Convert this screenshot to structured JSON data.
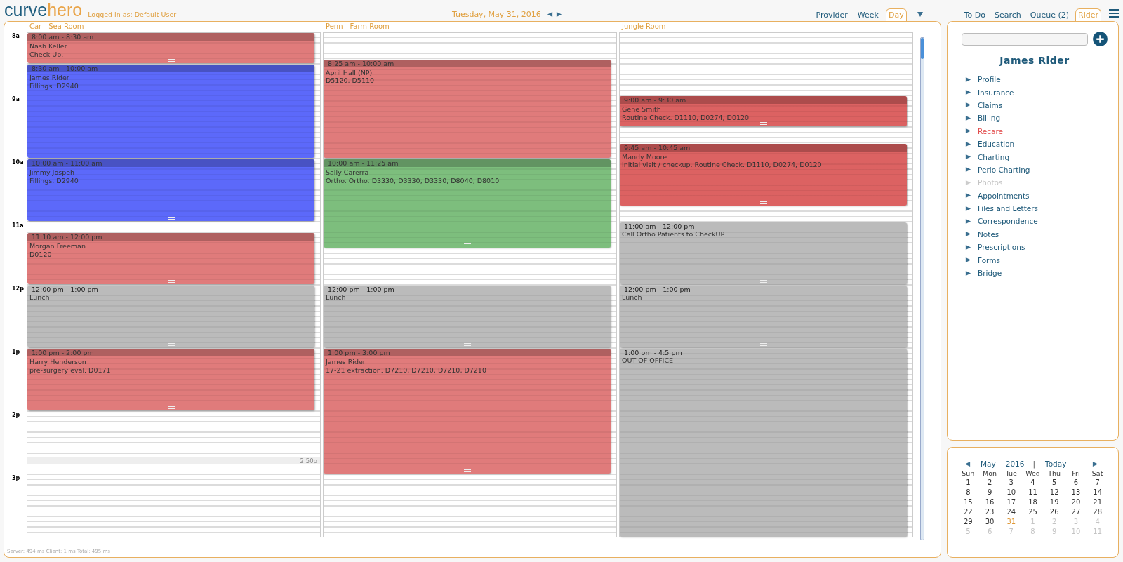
{
  "header": {
    "logo": [
      "curve",
      "hero"
    ],
    "logged_in": "Logged in as: Default User",
    "date": "Tuesday, May 31, 2016",
    "view_tabs": [
      {
        "label": "Provider",
        "selected": false
      },
      {
        "label": "Week",
        "selected": false
      },
      {
        "label": "Day",
        "selected": true
      }
    ],
    "side_tabs": [
      {
        "label": "To Do",
        "selected": false
      },
      {
        "label": "Search",
        "selected": false
      },
      {
        "label": "Queue (2)",
        "selected": false
      },
      {
        "label": "Rider",
        "selected": true
      }
    ]
  },
  "schedule": {
    "hours": [
      "8a",
      "9a",
      "10a",
      "11a",
      "12p",
      "1p",
      "2p",
      "3p"
    ],
    "columns": [
      {
        "room": "Car - Sea Room",
        "marker": "2:50p",
        "appointments": [
          {
            "kind": "appointment",
            "color": "#e07b7b",
            "time": "8:00 am - 8:30 am",
            "lines": [
              "Nash Keller",
              "Check Up."
            ]
          },
          {
            "kind": "appointment",
            "color": "#5c69fa",
            "time": "8:30 am - 10:00 am",
            "lines": [
              "James Rider",
              "Fillings. D2940"
            ]
          },
          {
            "kind": "appointment",
            "color": "#5c69fa",
            "time": "10:00 am - 11:00 am",
            "lines": [
              "Jimmy Jospeh",
              "Fillings. D2940"
            ]
          },
          {
            "kind": "appointment",
            "color": "#e07b7b",
            "time": "11:10 am - 12:00 pm",
            "lines": [
              "Morgan Freeman",
              "D0120"
            ]
          },
          {
            "kind": "block",
            "color": "#bbbbbb",
            "time": "12:00 pm - 1:00 pm",
            "lines": [
              "Lunch"
            ]
          },
          {
            "kind": "appointment",
            "color": "#e07b7b",
            "time": "1:00 pm - 2:00 pm",
            "lines": [
              "Harry Henderson",
              "pre-surgery eval. D0171"
            ]
          }
        ]
      },
      {
        "room": "Penn - Farm Room",
        "appointments": [
          {
            "kind": "appointment",
            "color": "#e07b7b",
            "time": "8:25 am - 10:00 am",
            "lines": [
              "April Hall (NP)",
              "D5120, D5110"
            ]
          },
          {
            "kind": "appointment",
            "color": "#7dbe7d",
            "time": "10:00 am - 11:25 am",
            "lines": [
              "Sally Carerra",
              "Ortho. Ortho. D3330, D3330, D3330, D8040, D8010"
            ]
          },
          {
            "kind": "block",
            "color": "#bbbbbb",
            "time": "12:00 pm - 1:00 pm",
            "lines": [
              "Lunch"
            ]
          },
          {
            "kind": "appointment",
            "color": "#e07b7b",
            "time": "1:00 pm - 3:00 pm",
            "lines": [
              "James Rider",
              "17-21 extraction. D7210, D7210, D7210, D7210"
            ]
          }
        ]
      },
      {
        "room": "Jungle Room",
        "appointments": [
          {
            "kind": "appointment",
            "color": "#dc6262",
            "time": "9:00 am - 9:30 am",
            "lines": [
              "Gene Smith",
              "Routine Check. D1110, D0274, D0120"
            ]
          },
          {
            "kind": "appointment",
            "color": "#dc6262",
            "time": "9:45 am - 10:45 am",
            "lines": [
              "Mandy Moore",
              "initial visit / checkup. Routine Check. D1110, D0274, D0120"
            ]
          },
          {
            "kind": "block",
            "color": "#bbbbbb",
            "time": "11:00 am - 12:00 pm",
            "lines": [
              "Call Ortho Patients to CheckUP"
            ]
          },
          {
            "kind": "block",
            "color": "#bbbbbb",
            "time": "12:00 pm - 1:00 pm",
            "lines": [
              "Lunch"
            ]
          },
          {
            "kind": "block",
            "color": "#bbbbbb",
            "time": "1:00 pm - 4:5 pm",
            "lines": [
              "OUT OF OFFICE"
            ]
          }
        ]
      }
    ],
    "footer": "Server: 494 ms Client: 1 ms Total: 495 ms"
  },
  "patient": {
    "name": "James Rider",
    "menu": [
      {
        "label": "Profile",
        "selected": false,
        "disabled": false
      },
      {
        "label": "Insurance",
        "selected": false,
        "disabled": false
      },
      {
        "label": "Claims",
        "selected": false,
        "disabled": false
      },
      {
        "label": "Billing",
        "selected": false,
        "disabled": false
      },
      {
        "label": "Recare",
        "selected": true,
        "disabled": false
      },
      {
        "label": "Education",
        "selected": false,
        "disabled": false
      },
      {
        "label": "Charting",
        "selected": false,
        "disabled": false
      },
      {
        "label": "Perio Charting",
        "selected": false,
        "disabled": false
      },
      {
        "label": "Photos",
        "selected": false,
        "disabled": true
      },
      {
        "label": "Appointments",
        "selected": false,
        "disabled": false
      },
      {
        "label": "Files and Letters",
        "selected": false,
        "disabled": false
      },
      {
        "label": "Correspondence",
        "selected": false,
        "disabled": false
      },
      {
        "label": "Notes",
        "selected": false,
        "disabled": false
      },
      {
        "label": "Prescriptions",
        "selected": false,
        "disabled": false
      },
      {
        "label": "Forms",
        "selected": false,
        "disabled": false
      },
      {
        "label": "Bridge",
        "selected": false,
        "disabled": false
      }
    ]
  },
  "mini_calendar": {
    "month": "May",
    "year": "2016",
    "separator": "|",
    "today_link": "Today",
    "weekdays": [
      "Sun",
      "Mon",
      "Tue",
      "Wed",
      "Thu",
      "Fri",
      "Sat"
    ],
    "weeks": [
      [
        {
          "day": "1",
          "outside": false,
          "selected": false
        },
        {
          "day": "2",
          "outside": false,
          "selected": false
        },
        {
          "day": "3",
          "outside": false,
          "selected": false
        },
        {
          "day": "4",
          "outside": false,
          "selected": false
        },
        {
          "day": "5",
          "outside": false,
          "selected": false
        },
        {
          "day": "6",
          "outside": false,
          "selected": false
        },
        {
          "day": "7",
          "outside": false,
          "selected": false
        }
      ],
      [
        {
          "day": "8",
          "outside": false,
          "selected": false
        },
        {
          "day": "9",
          "outside": false,
          "selected": false
        },
        {
          "day": "10",
          "outside": false,
          "selected": false
        },
        {
          "day": "11",
          "outside": false,
          "selected": false
        },
        {
          "day": "12",
          "outside": false,
          "selected": false
        },
        {
          "day": "13",
          "outside": false,
          "selected": false
        },
        {
          "day": "14",
          "outside": false,
          "selected": false
        }
      ],
      [
        {
          "day": "15",
          "outside": false,
          "selected": false
        },
        {
          "day": "16",
          "outside": false,
          "selected": false
        },
        {
          "day": "17",
          "outside": false,
          "selected": false
        },
        {
          "day": "18",
          "outside": false,
          "selected": false
        },
        {
          "day": "19",
          "outside": false,
          "selected": false
        },
        {
          "day": "20",
          "outside": false,
          "selected": false
        },
        {
          "day": "21",
          "outside": false,
          "selected": false
        }
      ],
      [
        {
          "day": "22",
          "outside": false,
          "selected": false
        },
        {
          "day": "23",
          "outside": false,
          "selected": false
        },
        {
          "day": "24",
          "outside": false,
          "selected": false
        },
        {
          "day": "25",
          "outside": false,
          "selected": false
        },
        {
          "day": "26",
          "outside": false,
          "selected": false
        },
        {
          "day": "27",
          "outside": false,
          "selected": false
        },
        {
          "day": "28",
          "outside": false,
          "selected": false
        }
      ],
      [
        {
          "day": "29",
          "outside": false,
          "selected": false
        },
        {
          "day": "30",
          "outside": false,
          "selected": false
        },
        {
          "day": "31",
          "outside": false,
          "selected": true
        },
        {
          "day": "1",
          "outside": true,
          "selected": false
        },
        {
          "day": "2",
          "outside": true,
          "selected": false
        },
        {
          "day": "3",
          "outside": true,
          "selected": false
        },
        {
          "day": "4",
          "outside": true,
          "selected": false
        }
      ],
      [
        {
          "day": "5",
          "outside": true,
          "selected": false
        },
        {
          "day": "6",
          "outside": true,
          "selected": false
        },
        {
          "day": "7",
          "outside": true,
          "selected": false
        },
        {
          "day": "8",
          "outside": true,
          "selected": false
        },
        {
          "day": "9",
          "outside": true,
          "selected": false
        },
        {
          "day": "10",
          "outside": true,
          "selected": false
        },
        {
          "day": "11",
          "outside": true,
          "selected": false
        }
      ]
    ]
  }
}
